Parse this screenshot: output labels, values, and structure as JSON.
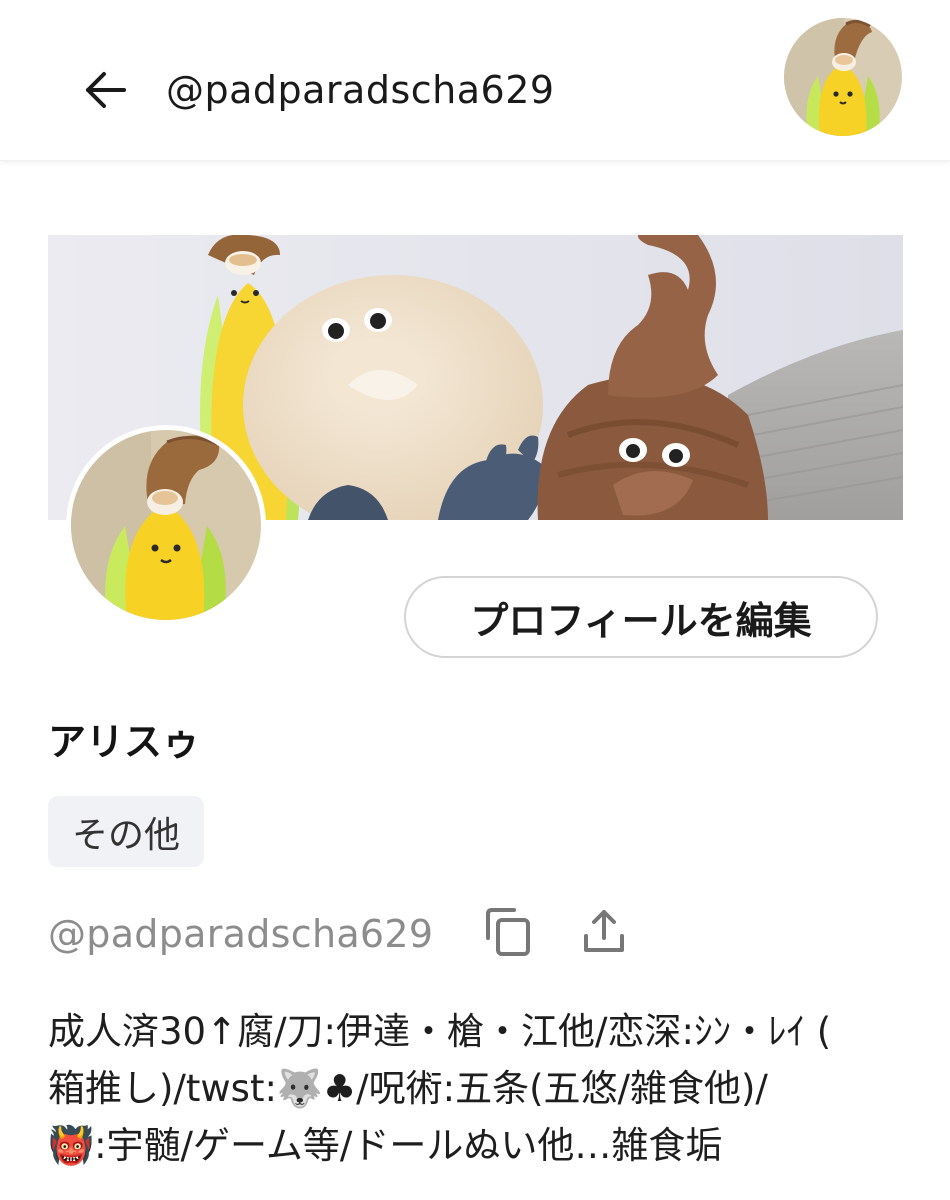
{
  "header": {
    "title": "@padparadscha629",
    "back_icon": "arrow-left-icon",
    "avatar_icon": "user-avatar"
  },
  "profile": {
    "edit_button_label": "プロフィールを編集",
    "display_name": "アリスゥ",
    "category_tag": "その他",
    "handle": "@padparadscha629",
    "copy_icon": "copy-icon",
    "share_icon": "share-upload-icon"
  },
  "bio": {
    "lines": [
      "成人済30↑腐/刀:伊達・槍・江他/恋深:ｼﾝ・ﾚｲ (",
      "箱推し)/twst:🐺♣/呪術:五条(五悠/雑食他)/",
      "👹:宇髄/ゲーム等/ドールぬい他…雑食垢"
    ]
  },
  "colors": {
    "background": "#ffffff",
    "text_primary": "#1a1a1a",
    "text_secondary": "#8c8c8c",
    "tag_background": "#f0f2f5",
    "button_border": "#d4d4d4"
  }
}
